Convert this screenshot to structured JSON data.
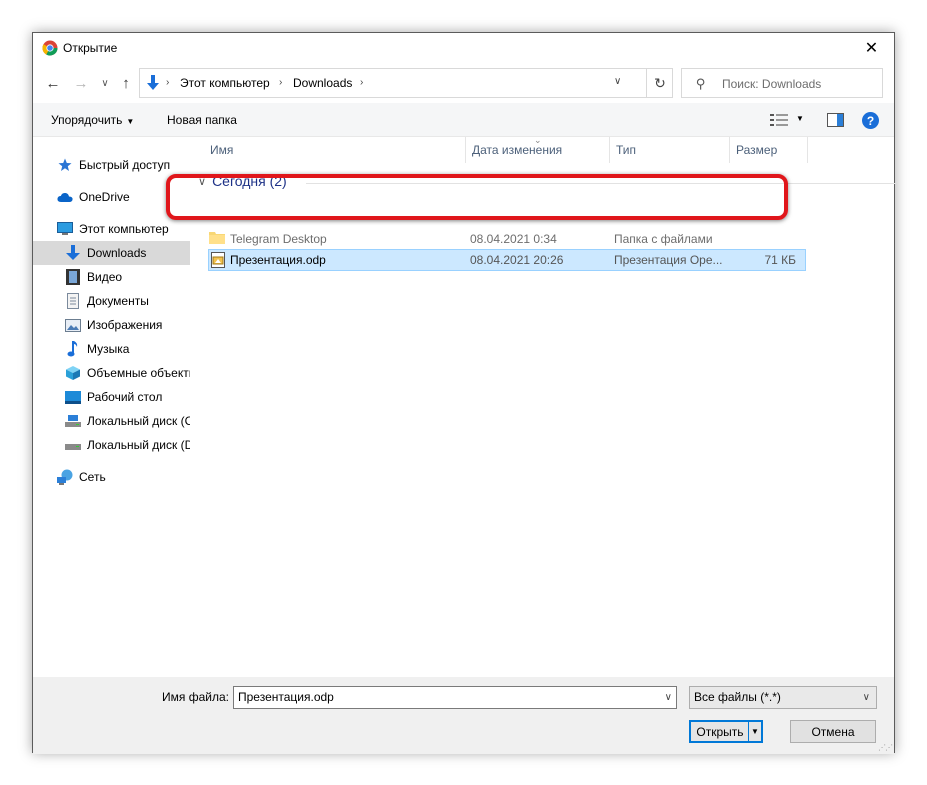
{
  "window": {
    "title": "Открытие",
    "close_glyph": "✕"
  },
  "nav": {
    "back": "←",
    "forward": "→",
    "recent": "∨",
    "up": "↑"
  },
  "address": {
    "crumbs": [
      "Этот компьютер",
      "Downloads"
    ],
    "refresh": "↻",
    "dropdown": "∨"
  },
  "search": {
    "placeholder": "Поиск: Downloads"
  },
  "toolbar": {
    "organize_label": "Упорядочить",
    "new_folder_label": "Новая папка",
    "help_label": "?"
  },
  "sidebar": {
    "items": [
      {
        "label": "Быстрый доступ",
        "icon": "star-icon"
      },
      {
        "label": "OneDrive",
        "icon": "cloud-icon"
      },
      {
        "label": "Этот компьютер",
        "icon": "computer-icon"
      },
      {
        "label": "Downloads",
        "icon": "download-icon"
      },
      {
        "label": "Видео",
        "icon": "video-icon"
      },
      {
        "label": "Документы",
        "icon": "document-icon"
      },
      {
        "label": "Изображения",
        "icon": "image-icon"
      },
      {
        "label": "Музыка",
        "icon": "music-icon"
      },
      {
        "label": "Объемные объекты",
        "icon": "cube-icon"
      },
      {
        "label": "Рабочий стол",
        "icon": "desktop-icon"
      },
      {
        "label": "Локальный диск (C:)",
        "icon": "disk-icon"
      },
      {
        "label": "Локальный диск (D:)",
        "icon": "disk-icon"
      },
      {
        "label": "Сеть",
        "icon": "network-icon"
      }
    ]
  },
  "columns": {
    "name": "Имя",
    "date": "Дата изменения",
    "type": "Тип",
    "size": "Размер"
  },
  "group": {
    "label": "Сегодня (2)"
  },
  "files": [
    {
      "name": "Telegram Desktop",
      "date": "08.04.2021 0:34",
      "type": "Папка с файлами",
      "size": ""
    },
    {
      "name": "Презентация.odp",
      "date": "08.04.2021 20:26",
      "type": "Презентация Ope...",
      "size": "71 КБ"
    }
  ],
  "footer": {
    "filename_label": "Имя файла:",
    "filename_value": "Презентация.odp",
    "filetype_value": "Все файлы (*.*)",
    "open_label": "Открыть",
    "cancel_label": "Отмена"
  },
  "colors": {
    "selection": "#cce8ff",
    "highlight_border": "#e0161b",
    "accent": "#0078d7"
  }
}
